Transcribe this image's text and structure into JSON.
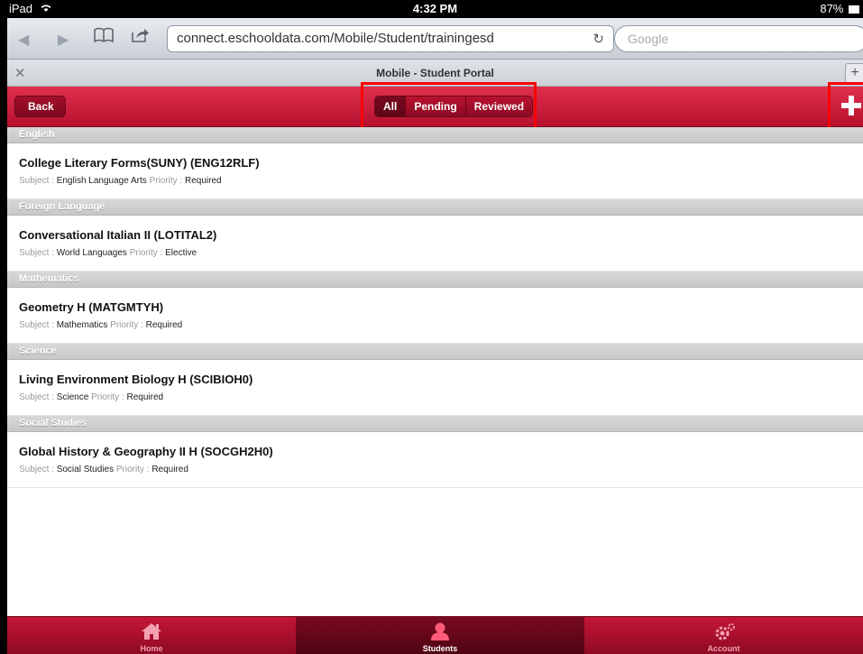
{
  "status_bar": {
    "device": "iPad",
    "time": "4:32 PM",
    "battery": "87%"
  },
  "browser": {
    "url": "connect.eschooldata.com/Mobile/Student/trainingesd",
    "search_placeholder": "Google",
    "tab_title": "Mobile - Student Portal"
  },
  "header": {
    "back_label": "Back",
    "filters": [
      "All",
      "Pending",
      "Reviewed"
    ],
    "selected_filter": "All"
  },
  "labels": {
    "subject": "Subject :",
    "priority": "Priority :"
  },
  "sections": [
    {
      "name": "English",
      "course": "College Literary Forms(SUNY)  (ENG12RLF)",
      "subject": "English Language Arts",
      "priority": "Required"
    },
    {
      "name": "Foreign Language",
      "course": "Conversational Italian II  (LOTITAL2)",
      "subject": "World Languages",
      "priority": "Elective"
    },
    {
      "name": "Mathematics",
      "course": "Geometry H  (MATGMTYH)",
      "subject": "Mathematics",
      "priority": "Required"
    },
    {
      "name": "Science",
      "course": "Living Environment Biology H  (SCIBIOH0)",
      "subject": "Science",
      "priority": "Required"
    },
    {
      "name": "Social Studies",
      "course": "Global History & Geography II H  (SOCGH2H0)",
      "subject": "Social Studies",
      "priority": "Required"
    }
  ],
  "bottom_tabs": [
    {
      "label": "Home",
      "icon": "home-icon"
    },
    {
      "label": "Students",
      "icon": "person-icon"
    },
    {
      "label": "Account",
      "icon": "gear-icon"
    }
  ],
  "active_tab": "Students",
  "colors": {
    "accent": "#c41636",
    "highlight": "#ff0000"
  }
}
